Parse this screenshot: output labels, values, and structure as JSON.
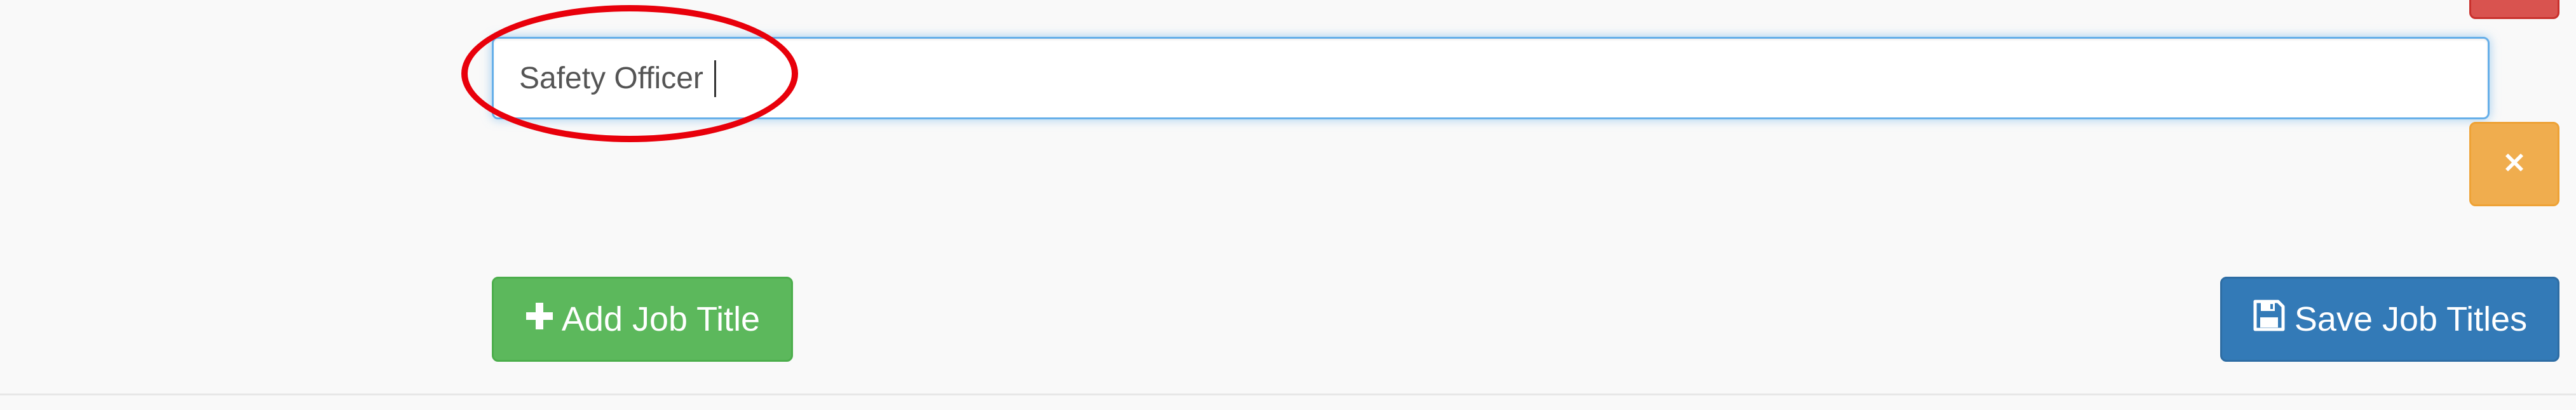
{
  "job_title_input": {
    "value": "Safety Officer"
  },
  "remove_button": {
    "icon": "close-icon"
  },
  "add_button": {
    "icon": "plus-icon",
    "label": "Add Job Title"
  },
  "save_button": {
    "icon": "floppy-disk-icon",
    "label": "Save Job Titles"
  },
  "colors": {
    "background": "#f9f9f9",
    "input_focus_border": "#66afe9",
    "annotation_red": "#e8000b",
    "success_green": "#5cb85c",
    "warning_orange": "#f0ad4e",
    "primary_blue": "#337ab7",
    "danger_red": "#d9534f"
  }
}
